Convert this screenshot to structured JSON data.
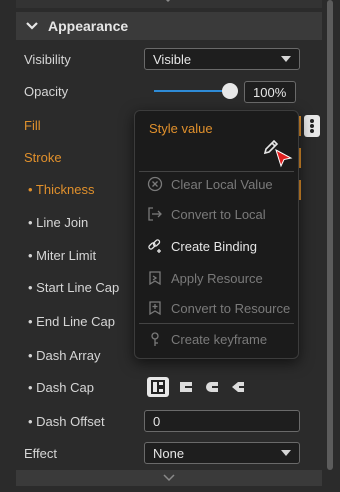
{
  "section": {
    "title": "Appearance"
  },
  "labels": {
    "visibility": "Visibility",
    "opacity": "Opacity",
    "fill": "Fill",
    "stroke": "Stroke",
    "thickness": "• Thickness",
    "line_join": "• Line Join",
    "miter_limit": "• Miter Limit",
    "start_line_cap": "• Start Line Cap",
    "end_line_cap": "• End Line Cap",
    "dash_array": "• Dash Array",
    "dash_cap": "• Dash Cap",
    "dash_offset": "• Dash Offset",
    "effect": "Effect"
  },
  "values": {
    "visibility": "Visible",
    "opacity": "100%",
    "opacity_fraction": 1.0,
    "dash_offset": "0",
    "effect": "None"
  },
  "dash_cap_options": [
    {
      "icon": "flat-cap-icon",
      "selected": true
    },
    {
      "icon": "square-cap-icon",
      "selected": false
    },
    {
      "icon": "round-cap-icon",
      "selected": false
    },
    {
      "icon": "triangle-cap-icon",
      "selected": false
    }
  ],
  "popup": {
    "title": "Style value",
    "items": [
      {
        "label": "Clear Local Value",
        "icon": "clear-icon",
        "enabled": false
      },
      {
        "label": "Convert to Local",
        "icon": "convert-local-icon",
        "enabled": false
      },
      {
        "label": "Create Binding",
        "icon": "binding-icon",
        "enabled": true
      },
      {
        "label": "Apply Resource",
        "icon": "apply-resource-icon",
        "enabled": false
      },
      {
        "label": "Convert to Resource",
        "icon": "convert-resource-icon",
        "enabled": false
      },
      {
        "label": "Create keyframe",
        "icon": "keyframe-icon",
        "enabled": false
      }
    ]
  },
  "colors": {
    "accent_orange": "#e0902c",
    "slider_blue": "#2e8bd6",
    "cursor_red": "#e02020"
  }
}
